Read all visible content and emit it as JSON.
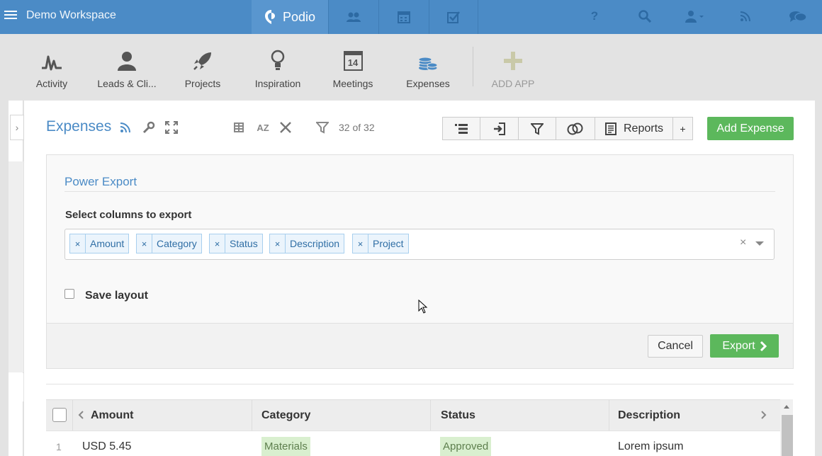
{
  "topbar": {
    "workspace_title": "Demo Workspace",
    "brand": "Podio",
    "nav_icons": [
      "contacts-icon",
      "calendar-icon",
      "tasks-icon"
    ],
    "right_icons": [
      "help-icon",
      "search-icon",
      "user-menu-icon",
      "activity-feed-icon",
      "chat-icon"
    ]
  },
  "apps": [
    {
      "label": "Activity",
      "icon": "activity-icon"
    },
    {
      "label": "Leads & Cli...",
      "icon": "leads-icon"
    },
    {
      "label": "Projects",
      "icon": "rocket-icon"
    },
    {
      "label": "Inspiration",
      "icon": "lightbulb-icon"
    },
    {
      "label": "Meetings",
      "icon": "calendar-14-icon",
      "calendar_day": "14"
    },
    {
      "label": "Expenses",
      "icon": "coins-icon"
    },
    {
      "label": "ADD APP",
      "icon": "plus-icon"
    }
  ],
  "header": {
    "title": "Expenses",
    "count": "32 of 32",
    "reports_label": "Reports",
    "plus_label": "+",
    "add_label": "Add Expense"
  },
  "export": {
    "title": "Power Export",
    "select_label": "Select columns to export",
    "chips": [
      "Amount",
      "Category",
      "Status",
      "Description",
      "Project"
    ],
    "chip_remove": "×",
    "clear": "×",
    "save_layout_label": "Save layout",
    "save_layout_checked": false,
    "cancel_label": "Cancel",
    "export_label": "Export"
  },
  "table": {
    "columns": [
      "Amount",
      "Category",
      "Status",
      "Description"
    ],
    "rows": [
      {
        "num": "1",
        "amount": "USD 5.45",
        "category": "Materials",
        "status": "Approved",
        "description": "Lorem ipsum"
      }
    ]
  },
  "colors": {
    "brand_blue": "#4b8bc6",
    "success_green": "#5cb85c",
    "tag_green_bg": "#d9efcf"
  }
}
